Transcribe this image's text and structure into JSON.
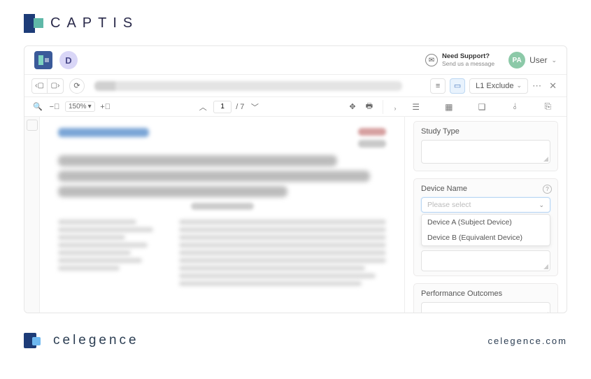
{
  "brand": {
    "name": "CAPTIS"
  },
  "header": {
    "avatar_d": "D",
    "support_title": "Need Support?",
    "support_sub": "Send us a message",
    "user_initials": "PA",
    "user_label": "User"
  },
  "subbar": {
    "exclude_label": "L1 Exclude"
  },
  "pdf": {
    "zoom": "150%",
    "page_current": "1",
    "page_total": "/ 7"
  },
  "form": {
    "study_type_label": "Study Type",
    "device_name_label": "Device Name",
    "device_placeholder": "Please select",
    "device_options": [
      "Device A (Subject Device)",
      "Device B (Equivalent Device)"
    ],
    "perf_label": "Performance Outcomes"
  },
  "footer": {
    "brand": "celegence",
    "url": "celegence.com"
  }
}
